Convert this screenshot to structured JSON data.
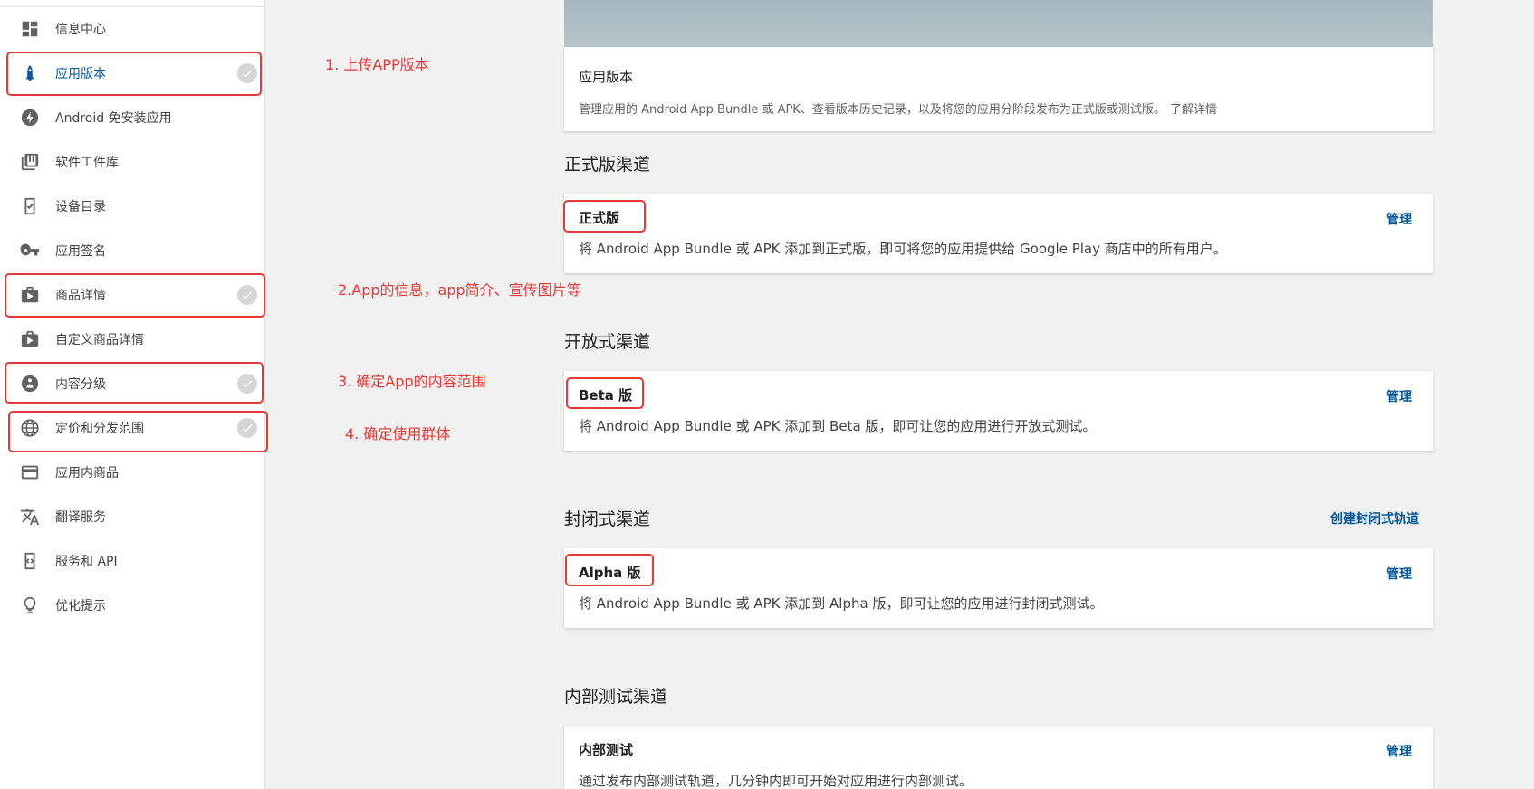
{
  "sidebar": {
    "items": [
      {
        "label": "信息中心",
        "icon": "dashboard-icon",
        "checked": false
      },
      {
        "label": "应用版本",
        "icon": "rocket-icon",
        "checked": true,
        "active": true
      },
      {
        "label": "Android 免安装应用",
        "icon": "bolt-icon",
        "checked": false
      },
      {
        "label": "软件工件库",
        "icon": "library-icon",
        "checked": false
      },
      {
        "label": "设备目录",
        "icon": "device-icon",
        "checked": false
      },
      {
        "label": "应用签名",
        "icon": "key-icon",
        "checked": false
      },
      {
        "label": "商品详情",
        "icon": "store-listing-icon",
        "checked": true
      },
      {
        "label": "自定义商品详情",
        "icon": "store-listing-icon",
        "checked": false
      },
      {
        "label": "内容分级",
        "icon": "content-rating-icon",
        "checked": true
      },
      {
        "label": "定价和分发范围",
        "icon": "globe-icon",
        "checked": true
      },
      {
        "label": "应用内商品",
        "icon": "credit-card-icon",
        "checked": false
      },
      {
        "label": "翻译服务",
        "icon": "translate-icon",
        "checked": false
      },
      {
        "label": "服务和 API",
        "icon": "api-icon",
        "checked": false
      },
      {
        "label": "优化提示",
        "icon": "lightbulb-icon",
        "checked": false
      }
    ]
  },
  "annotations": {
    "a1": "1. 上传APP版本",
    "a2": "2.App的信息，app简介、宣传图片等",
    "a3": "3. 确定App的内容范围",
    "a4": "4. 确定使用群体"
  },
  "header_card": {
    "title": "应用版本",
    "desc": "管理应用的 Android App Bundle 或 APK、查看版本历史记录，以及将您的应用分阶段发布为正式版或测试版。",
    "link": "了解详情"
  },
  "tracks": {
    "production": {
      "section": "正式版渠道",
      "title": "正式版",
      "desc": "将 Android App Bundle 或 APK 添加到正式版，即可将您的应用提供给 Google Play 商店中的所有用户。",
      "manage": "管理"
    },
    "open": {
      "section": "开放式渠道",
      "title": "Beta 版",
      "desc": "将 Android App Bundle 或 APK 添加到 Beta 版，即可让您的应用进行开放式测试。",
      "manage": "管理"
    },
    "closed": {
      "section": "封闭式渠道",
      "create": "创建封闭式轨道",
      "title": "Alpha 版",
      "desc": "将 Android App Bundle 或 APK 添加到 Alpha 版，即可让您的应用进行封闭式测试。",
      "manage": "管理"
    },
    "internal": {
      "section": "内部测试渠道",
      "title": "内部测试",
      "desc": "通过发布内部测试轨道，几分钟内即可开始对应用进行内部测试。",
      "manage": "管理"
    }
  },
  "colors": {
    "accent": "#01579b",
    "annotation": "#e53935"
  }
}
